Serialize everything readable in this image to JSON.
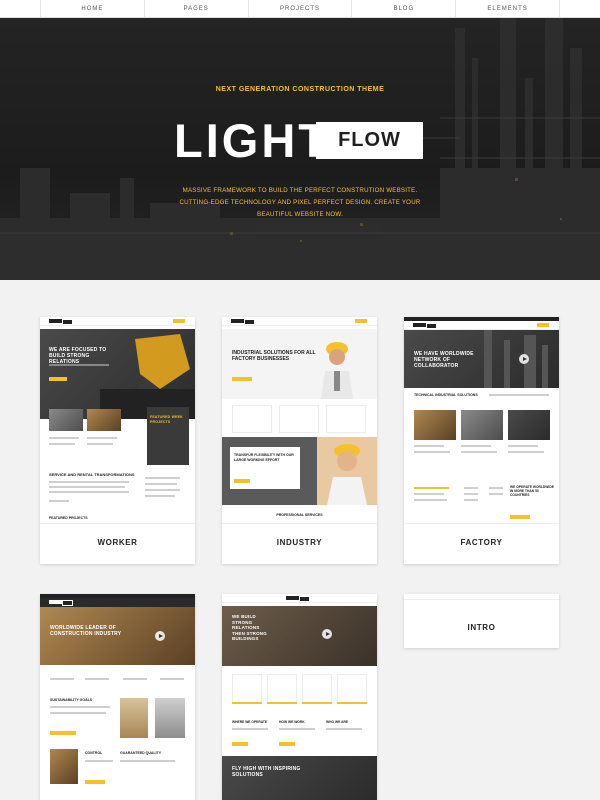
{
  "nav": {
    "items": [
      "HOME",
      "PAGES",
      "PROJECTS",
      "BLOG",
      "ELEMENTS"
    ]
  },
  "hero": {
    "tagline": "NEXT GENERATION CONSTRUCTION THEME",
    "brand_light": "LIGHT",
    "brand_flow": "FLOW",
    "description": "MASSIVE FRAMEWORK TO BUILD THE PERFECT CONSTRUTION WEBSITE. CUTTING-EDGE TECHNOLOGY AND PIXEL PERFECT DESIGN. CREATE YOUR BEAUTIFUL WEBSITE NOW."
  },
  "demos": {
    "worker": {
      "label": "WORKER",
      "hero_title": "WE ARE FOCUSED TO BUILD STRONG RELATIONS",
      "featured": "FEATURED WEEK PROJECTS",
      "section": "SERVICE AND RENTAL TRANSFORMATIONS",
      "footer": "FEATURED PROJECTS"
    },
    "industry": {
      "label": "INDUSTRY",
      "hero_title": "INDUSTRIAL SOLUTIONS FOR ALL FACTORY BUSINESSES",
      "promo": "TRANSFUR FLEXIBILITY WITH OUR LARGE WORKING EFFORT",
      "footer": "PROFESSIONAL SERVICES"
    },
    "factory": {
      "label": "FACTORY",
      "hero_title": "WE HAVE WORLDWIDE NETWORK OF COLLABORATOR",
      "section": "TECHNICAL INDUSTRIAL SOLUTIONS",
      "side": "WE OPERATE WORLDWIDE IN MORE THAN 50 COUNTRIES"
    },
    "fourth": {
      "hero_title": "WORLDWIDE LEADER OF CONSTRUCTION INDUSTRY",
      "section": "SUSTAINABILITY GOALS",
      "col1": "CONTROL",
      "col2": "GUARANTEED QUALITY"
    },
    "fifth": {
      "hero_title": "WE BUILD STRONG RELATIONS THEN STRONG BUILDINGS",
      "col1": "WHERE WE OPERATE",
      "col2": "HOW WE WORK",
      "col3": "WHO WE ARE",
      "promo": "FLY HIGH WITH INSPIRING SOLUTIONS"
    },
    "intro": {
      "label": "INTRO"
    }
  },
  "colors": {
    "accent": "#f5c12a",
    "dark": "#1f1f1f"
  }
}
